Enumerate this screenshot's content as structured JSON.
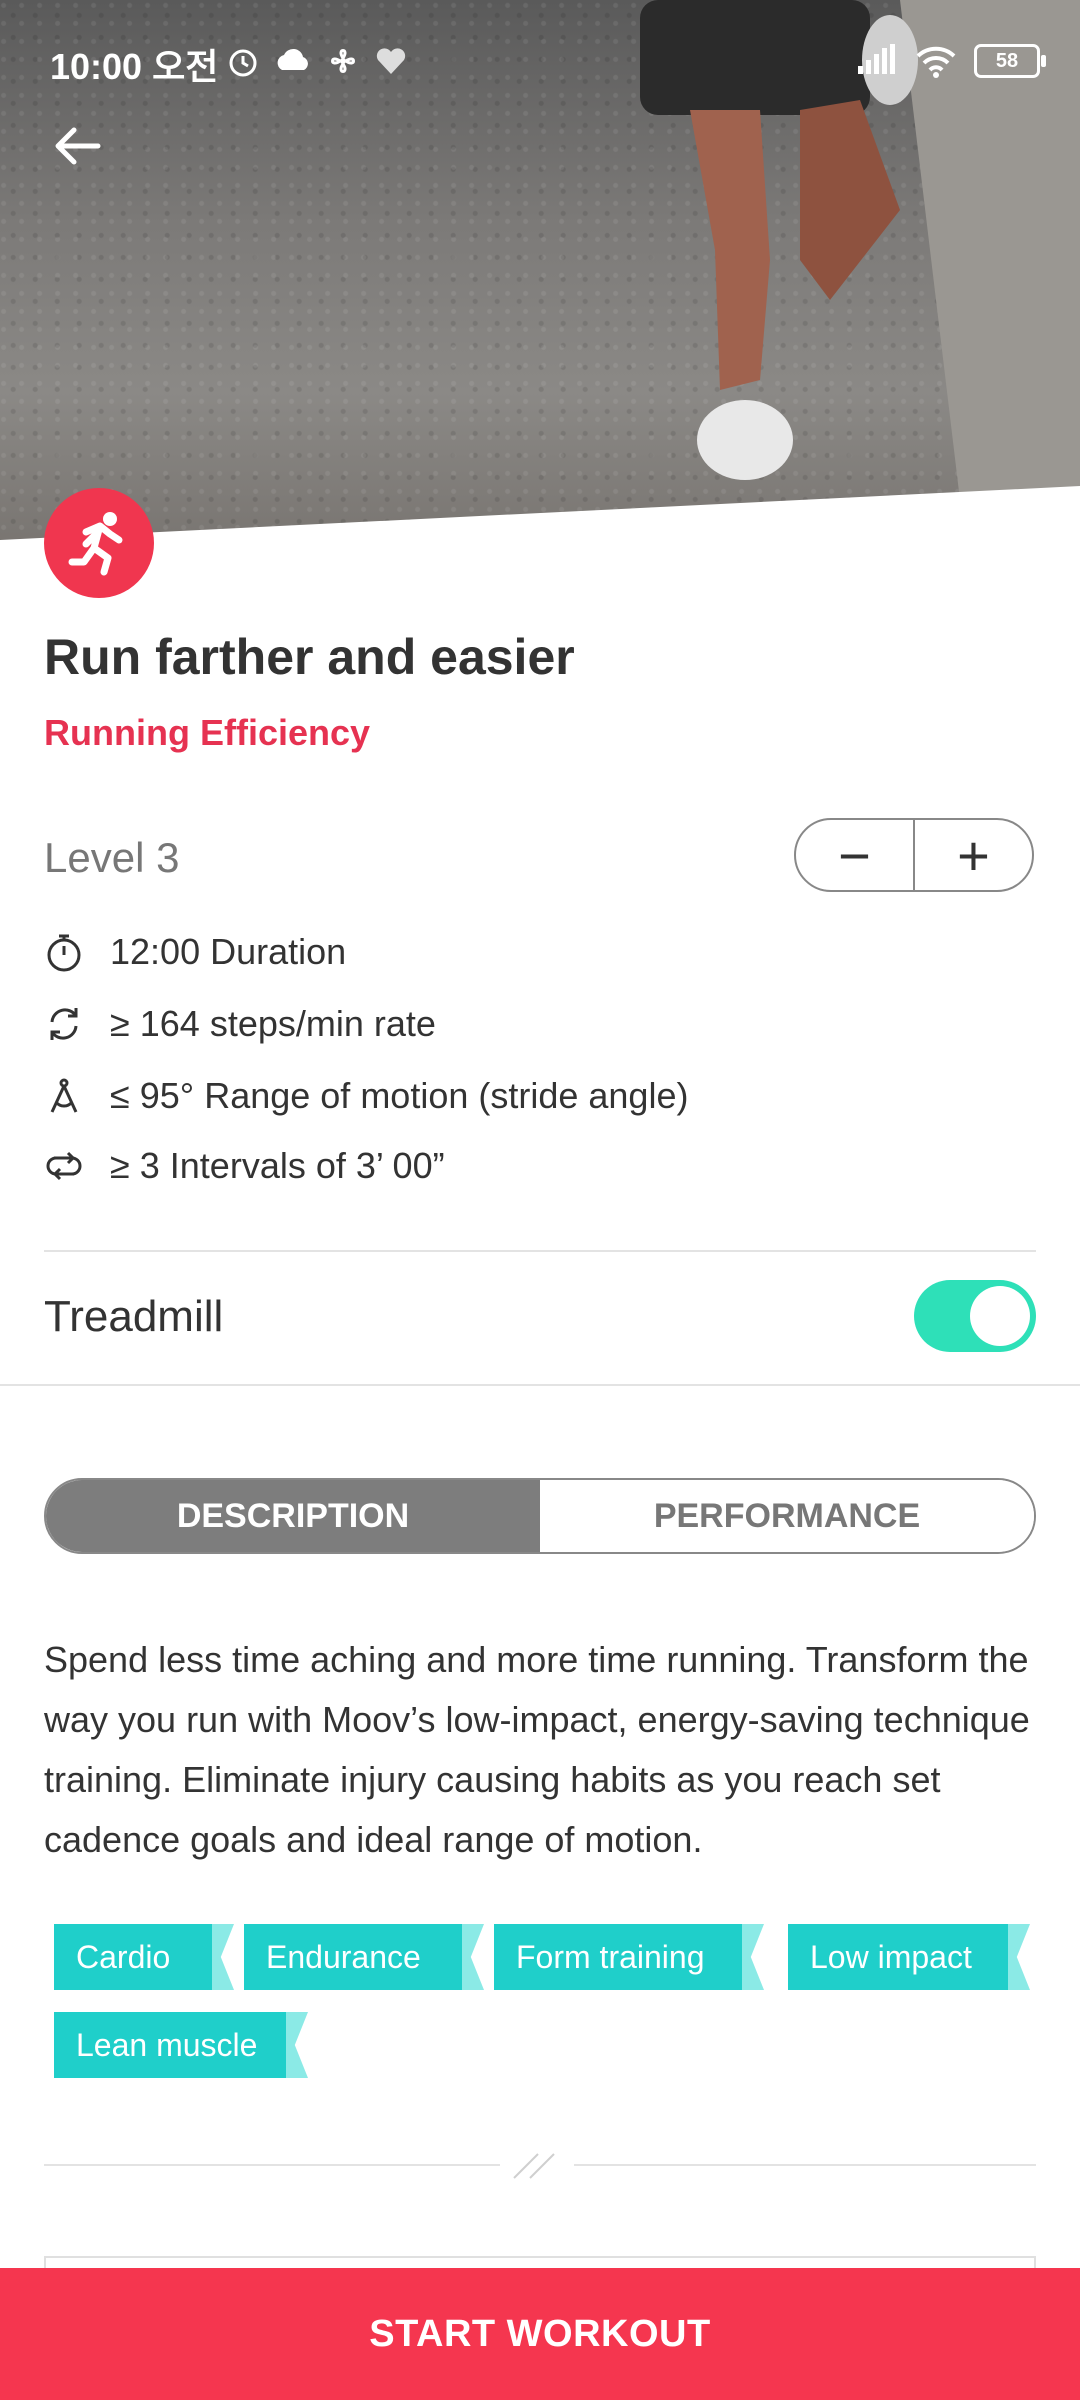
{
  "status_bar": {
    "time": "10:00 오전",
    "battery": "58"
  },
  "header": {
    "back_icon": "arrow-left-icon",
    "category_icon": "running-icon"
  },
  "workout": {
    "title": "Run farther and easier",
    "category": "Running Efficiency",
    "level": "Level 3",
    "stepper": {
      "minus": "−",
      "plus": "+"
    },
    "stats": [
      {
        "icon": "stopwatch-icon",
        "text": "12:00 Duration"
      },
      {
        "icon": "cadence-icon",
        "text": "≥ 164 steps/min rate"
      },
      {
        "icon": "stride-angle-icon",
        "text": "≤ 95° Range of motion (stride angle)"
      },
      {
        "icon": "intervals-icon",
        "text": "≥ 3 Intervals of 3’ 00”"
      }
    ],
    "treadmill_label": "Treadmill",
    "treadmill_on": true
  },
  "tabs": [
    {
      "label": "DESCRIPTION",
      "active": true
    },
    {
      "label": "PERFORMANCE",
      "active": false
    }
  ],
  "description": "Spend less time aching and more time running. Transform the way you run with Moov’s low-impact, energy-saving technique training. Eliminate injury causing habits as you reach set cadence goals and ideal range of motion.",
  "tags": [
    "Cardio",
    "Endurance",
    "Form training",
    "Low impact",
    "Lean muscle"
  ],
  "cta": {
    "label": "START WORKOUT"
  },
  "colors": {
    "accent": "#f5364f",
    "teal": "#1fcfca",
    "toggle": "#2ee0b8"
  }
}
